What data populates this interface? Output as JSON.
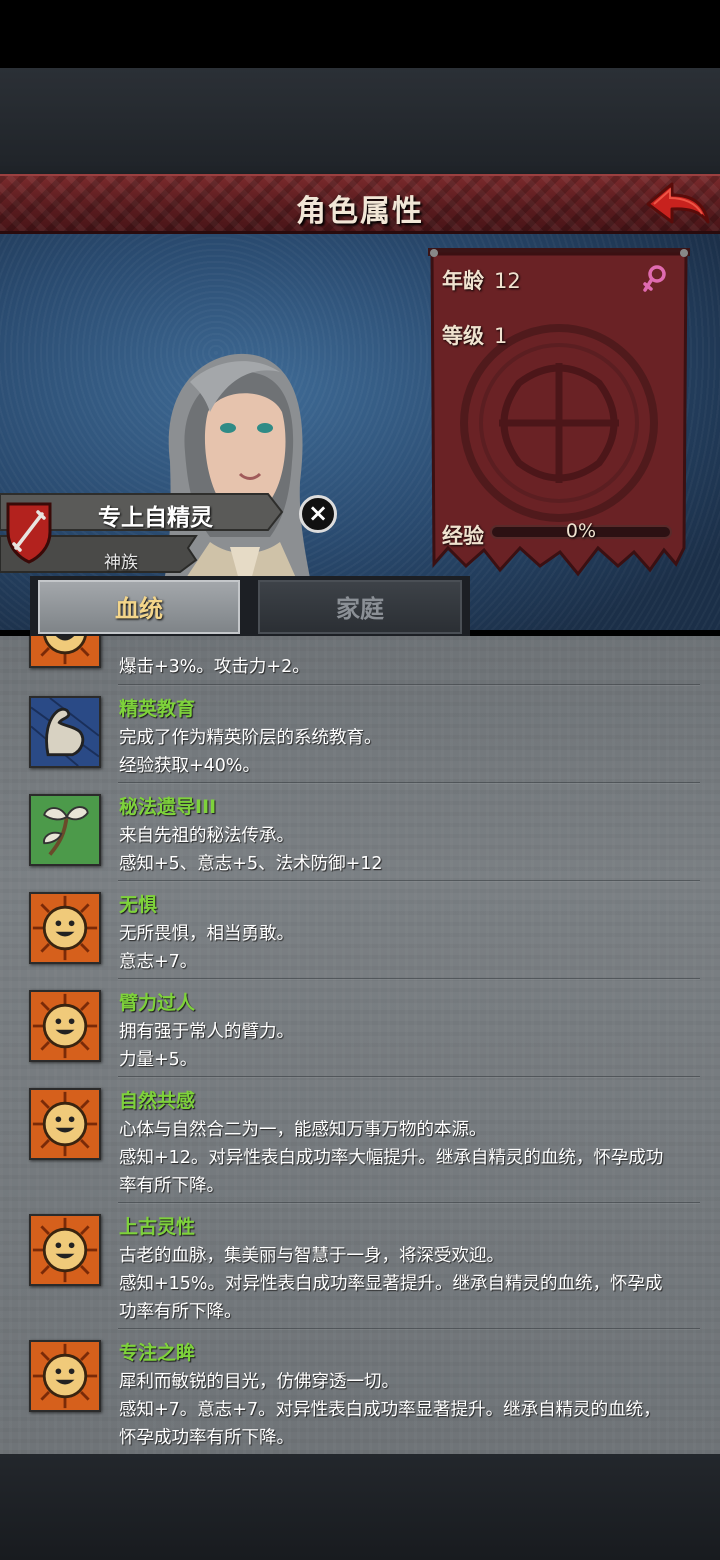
{
  "header": {
    "title": "角色属性"
  },
  "character": {
    "name": "专上自精灵",
    "race": "神族",
    "stats": {
      "age_label": "年龄",
      "age_value": "12",
      "level_label": "等级",
      "level_value": "1",
      "exp_label": "经验",
      "exp_percent": "0%",
      "exp_fraction": 0
    }
  },
  "tabs": [
    {
      "label": "血统",
      "active": true
    },
    {
      "label": "家庭",
      "active": false
    }
  ],
  "traits": [
    {
      "name": "",
      "lines": [
        "爆击+3%。攻击力+2。"
      ],
      "icon": "sun-face-icon"
    },
    {
      "name": "精英教育",
      "lines": [
        "完成了作为精英阶层的系统教育。",
        "经验获取+40%。"
      ],
      "icon": "flexed-arm-icon"
    },
    {
      "name": "秘法遗导III",
      "lines": [
        "来自先祖的秘法传承。",
        "感知+5、意志+5、法术防御+12"
      ],
      "icon": "sprout-icon"
    },
    {
      "name": "无惧",
      "lines": [
        "无所畏惧，相当勇敢。",
        "意志+7。"
      ],
      "icon": "sun-face-icon"
    },
    {
      "name": "臂力过人",
      "lines": [
        "拥有强于常人的臂力。",
        "力量+5。"
      ],
      "icon": "sun-face-icon"
    },
    {
      "name": "自然共感",
      "lines": [
        "心体与自然合二为一，能感知万事万物的本源。",
        "感知+12。对异性表白成功率大幅提升。继承自精灵的血统，怀孕成功",
        "率有所下降。"
      ],
      "icon": "sun-face-icon"
    },
    {
      "name": "上古灵性",
      "lines": [
        "古老的血脉，集美丽与智慧于一身，将深受欢迎。",
        "感知+15%。对异性表白成功率显著提升。继承自精灵的血统，怀孕成",
        "功率有所下降。"
      ],
      "icon": "sun-face-icon"
    },
    {
      "name": "专注之眸",
      "lines": [
        "犀利而敏锐的目光，仿佛穿透一切。",
        "感知+7。意志+7。对异性表白成功率显著提升。继承自精灵的血统，",
        "怀孕成功率有所下降。"
      ],
      "icon": "sun-face-icon"
    }
  ]
}
